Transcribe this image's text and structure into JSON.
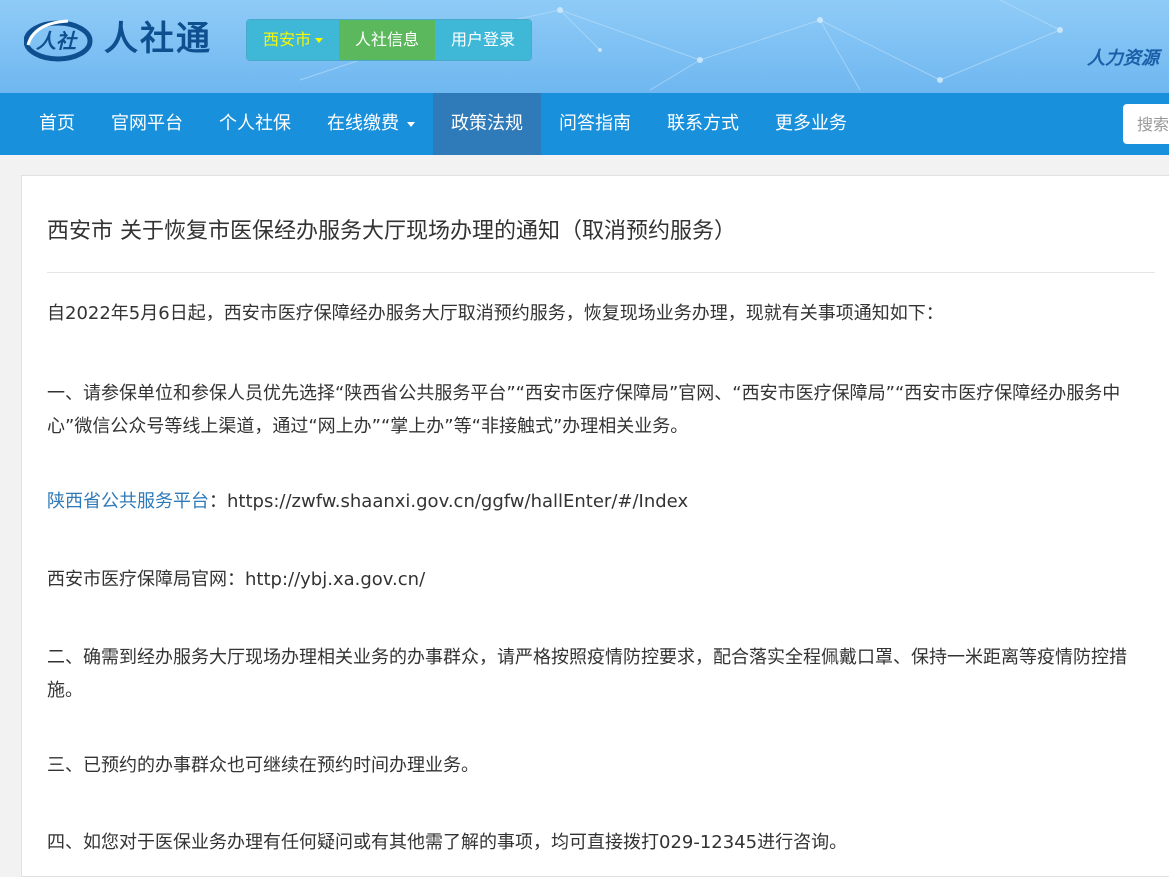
{
  "brand": {
    "logo_mark": "人社",
    "name": "人社通"
  },
  "topnav": {
    "city": "西安市",
    "info": "人社信息",
    "login": "用户登录"
  },
  "slogan": "人力资源",
  "mainnav": {
    "items": [
      "首页",
      "官网平台",
      "个人社保",
      "在线缴费",
      "政策法规",
      "问答指南",
      "联系方式",
      "更多业务"
    ],
    "active_index": 4,
    "dropdown_index": 3
  },
  "search": {
    "placeholder": "搜索"
  },
  "article": {
    "title": "西安市 关于恢复市医保经办服务大厅现场办理的通知（取消预约服务）",
    "intro": "自2022年5月6日起，西安市医疗保障经办服务大厅取消预约服务，恢复现场业务办理，现就有关事项通知如下：",
    "item1": "一、请参保单位和参保人员优先选择“陕西省公共服务平台”“西安市医疗保障局”官网、“西安市医疗保障局”“西安市医疗保障经办服务中心”微信公众号等线上渠道，通过“网上办”“掌上办”等“非接触式”办理相关业务。",
    "link1_label": "陕西省公共服务平台",
    "link1_sep": "：",
    "link1_url": "https://zwfw.shaanxi.gov.cn/ggfw/hallEnter/#/Index",
    "link2_label": "西安市医疗保障局官网：",
    "link2_url": "http://ybj.xa.gov.cn/",
    "item2": "二、确需到经办服务大厅现场办理相关业务的办事群众，请严格按照疫情防控要求，配合落实全程佩戴口罩、保持一米距离等疫情防控措施。",
    "item3": "三、已预约的办事群众也可继续在预约时间办理业务。",
    "item4": "四、如您对于医保业务办理有任何疑问或有其他需了解的事项，均可直接拨打029-12345进行咨询。"
  },
  "colors": {
    "nav_bg": "#1890dc",
    "nav_active": "#2f7ab8",
    "city_text": "#f7f700",
    "info_bg": "#5cb85c",
    "link": "#2f7ab8"
  }
}
